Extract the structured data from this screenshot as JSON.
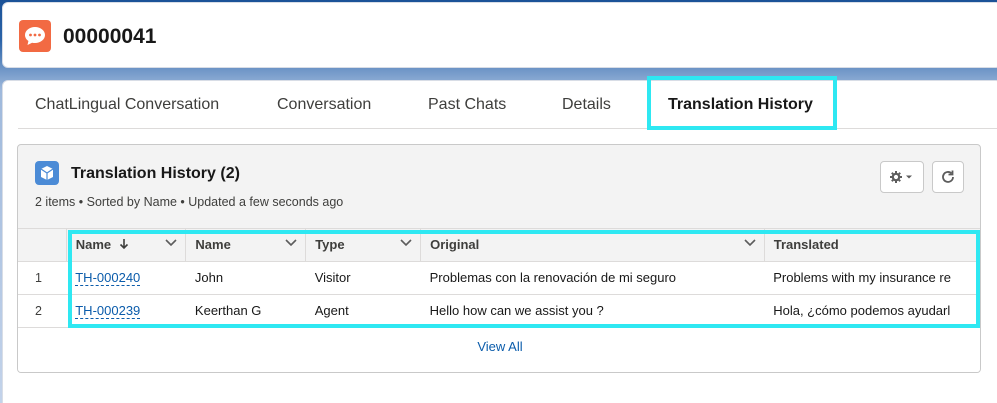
{
  "record": {
    "icon": "chat-bubble-icon",
    "icon_color": "#f26a43",
    "title": "00000041"
  },
  "tabs": [
    {
      "label": "ChatLingual Conversation"
    },
    {
      "label": "Conversation"
    },
    {
      "label": "Past Chats"
    },
    {
      "label": "Details"
    },
    {
      "label": "Translation History",
      "active": true
    }
  ],
  "related_list": {
    "icon": "cube-icon",
    "icon_color": "#4b8bd6",
    "title": "Translation History (2)",
    "meta": "2 items • Sorted by Name • Updated a few seconds ago",
    "columns": [
      "Name",
      "Name",
      "Type",
      "Original",
      "Translated"
    ],
    "sorted_column": "Name",
    "rows": [
      {
        "num": "1",
        "record_name": "TH-000240",
        "name": "John",
        "type": "Visitor",
        "original": "Problemas con la renovación de mi seguro",
        "translated": "Problems with my insurance re"
      },
      {
        "num": "2",
        "record_name": "TH-000239",
        "name": "Keerthan G",
        "type": "Agent",
        "original": "Hello how can we assist you ?",
        "translated": "Hola, ¿cómo podemos ayudarl"
      }
    ],
    "view_all": "View All"
  },
  "colors": {
    "highlight": "#2ee8f2",
    "link": "#0b5cab",
    "accent": "#0176d3"
  }
}
